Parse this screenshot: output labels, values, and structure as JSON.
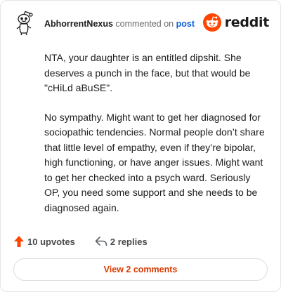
{
  "comment": {
    "author": "AbhorrentNexus",
    "action_text": "commented on",
    "post_link_label": "post",
    "paragraphs": [
      "NTA, your daughter is an entitled dipshit. She deserves a punch in the face, but that would be \"cHiLd aBuSE\".",
      "No sympathy. Might want to get her diagnosed for sociopathic tendencies. Normal people don’t share that little level of empathy, even if they’re bipolar, high functioning, or have anger issues. Might want to get her checked into a psych ward. Seriously OP, you need some support and she needs to be diagnosed again."
    ],
    "upvotes_label": "10 upvotes",
    "replies_label": "2 replies",
    "view_comments_label": "View 2 comments"
  },
  "brand": {
    "wordmark": "reddit",
    "icon": "reddit-logo-icon",
    "color": "#ff4500"
  },
  "icons": {
    "avatar": "snoo-avatar-icon",
    "upvote": "upvote-arrow-icon",
    "reply": "reply-arrow-icon"
  },
  "colors": {
    "upvote": "#ff4500",
    "link": "#0f5fd7",
    "view_button_text": "#d93a00"
  }
}
